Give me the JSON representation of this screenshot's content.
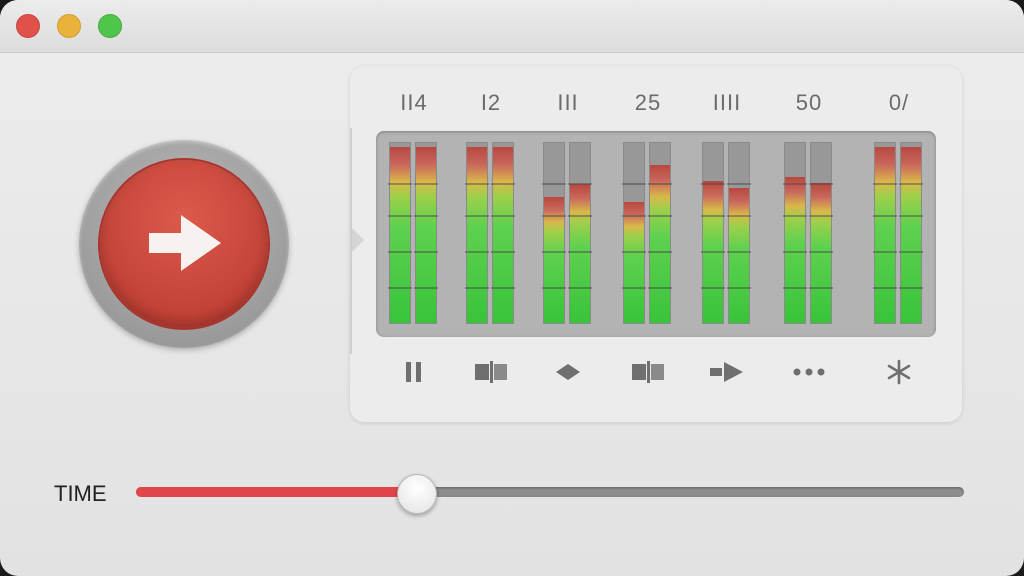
{
  "window": {
    "traffic_lights": [
      "close",
      "minimize",
      "maximize"
    ],
    "colors": {
      "close": "#e0514a",
      "minimize": "#e9b23a",
      "maximize": "#4fc64b"
    }
  },
  "record_button": {
    "icon": "arrow-right-icon",
    "color": "#c8463a"
  },
  "channels": [
    {
      "label": "II4",
      "left_level": 0.98,
      "right_level": 0.98
    },
    {
      "label": "I2",
      "left_level": 0.98,
      "right_level": 0.98
    },
    {
      "label": "III",
      "left_level": 0.7,
      "right_level": 0.77
    },
    {
      "label": "25",
      "left_level": 0.67,
      "right_level": 0.88
    },
    {
      "label": "IIII",
      "left_level": 0.79,
      "right_level": 0.75
    },
    {
      "label": "50",
      "left_level": 0.81,
      "right_level": 0.78
    },
    {
      "label": "0/",
      "left_level": 0.98,
      "right_level": 0.98
    }
  ],
  "controls": [
    {
      "name": "pause-icon"
    },
    {
      "name": "split-icon"
    },
    {
      "name": "diamond-icon"
    },
    {
      "name": "split-icon"
    },
    {
      "name": "forward-icon"
    },
    {
      "name": "more-icon"
    },
    {
      "name": "asterisk-icon"
    }
  ],
  "timeline": {
    "label": "TIME",
    "progress": 0.338,
    "accent": "#e0454a"
  }
}
